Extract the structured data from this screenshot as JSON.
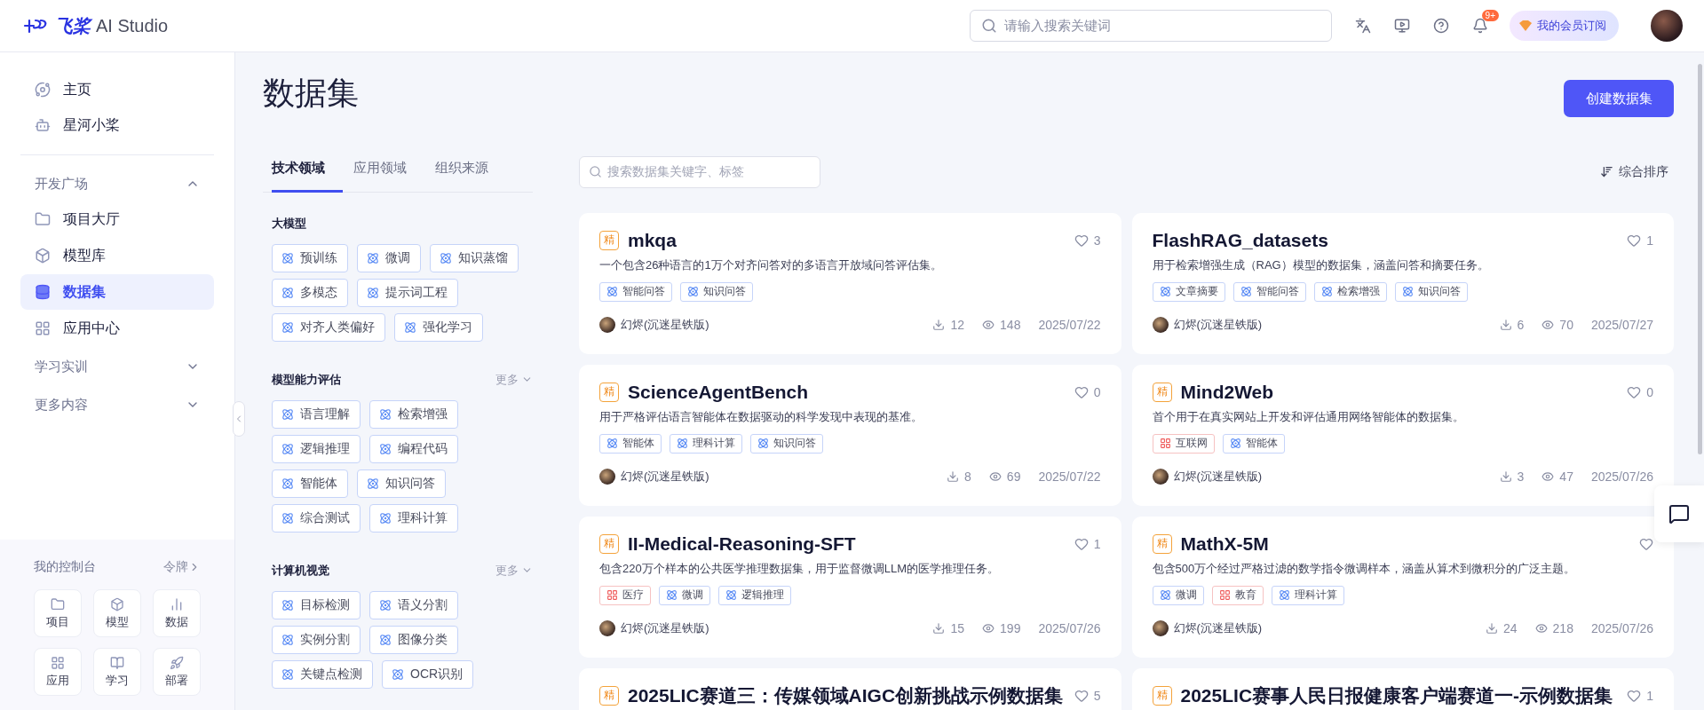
{
  "header": {
    "logo_mark": "飞桨",
    "logo_text": "AI Studio",
    "search": {
      "placeholder": "请输入搜索关键词"
    },
    "notification_badge": "9+",
    "membership_button": "我的会员订阅"
  },
  "sidebar": {
    "top_items": [
      {
        "label": "主页",
        "selected": false
      },
      {
        "label": "星河小桨",
        "selected": false
      }
    ],
    "sections": [
      {
        "label": "开发广场",
        "expanded": true,
        "items": [
          {
            "label": "项目大厅",
            "selected": false
          },
          {
            "label": "模型库",
            "selected": false
          },
          {
            "label": "数据集",
            "selected": true
          },
          {
            "label": "应用中心",
            "selected": false
          }
        ]
      },
      {
        "label": "学习实训",
        "expanded": false
      },
      {
        "label": "更多内容",
        "expanded": false
      }
    ],
    "console": {
      "title": "我的控制台",
      "link": "令牌",
      "shortcuts": [
        "项目",
        "模型",
        "数据",
        "应用",
        "学习",
        "部署"
      ]
    }
  },
  "page": {
    "title": "数据集",
    "create_button": "创建数据集"
  },
  "filters": {
    "tabs": [
      {
        "label": "技术领域",
        "selected": true
      },
      {
        "label": "应用领域",
        "selected": false
      },
      {
        "label": "组织来源",
        "selected": false
      }
    ],
    "groups": [
      {
        "title": "大模型",
        "tags": [
          "预训练",
          "微调",
          "知识蒸馏",
          "多模态",
          "提示词工程",
          "对齐人类偏好",
          "强化学习"
        ]
      },
      {
        "title": "模型能力评估",
        "more": "更多",
        "tags": [
          "语言理解",
          "检索增强",
          "逻辑推理",
          "编程代码",
          "智能体",
          "知识问答",
          "综合测试",
          "理科计算"
        ]
      },
      {
        "title": "计算机视觉",
        "more": "更多",
        "tags": [
          "目标检测",
          "语义分割",
          "实例分割",
          "图像分类",
          "关键点检测",
          "OCR识别"
        ]
      }
    ]
  },
  "search": {
    "placeholder": "搜索数据集关键字、标签"
  },
  "sort": "综合排序",
  "datasets": [
    {
      "badge": "精",
      "title": "mkqa",
      "likes": "3",
      "description": "一个包含26种语言的1万个对齐问答对的多语言开放域问答评估集。",
      "tags": [
        {
          "label": "智能问答",
          "kind": "tech"
        },
        {
          "label": "知识问答",
          "kind": "tech"
        }
      ],
      "author": "幻烬(沉迷星铁版)",
      "downloads": "12",
      "views": "148",
      "date": "2025/07/22"
    },
    {
      "title": "FlashRAG_datasets",
      "likes": "1",
      "description": "用于检索增强生成（RAG）模型的数据集，涵盖问答和摘要任务。",
      "tags": [
        {
          "label": "文章摘要",
          "kind": "tech"
        },
        {
          "label": "智能问答",
          "kind": "tech"
        },
        {
          "label": "检索增强",
          "kind": "tech"
        },
        {
          "label": "知识问答",
          "kind": "tech"
        }
      ],
      "author": "幻烬(沉迷星铁版)",
      "downloads": "6",
      "views": "70",
      "date": "2025/07/27"
    },
    {
      "badge": "精",
      "title": "ScienceAgentBench",
      "likes": "0",
      "description": "用于严格评估语言智能体在数据驱动的科学发现中表现的基准。",
      "tags": [
        {
          "label": "智能体",
          "kind": "tech"
        },
        {
          "label": "理科计算",
          "kind": "tech"
        },
        {
          "label": "知识问答",
          "kind": "tech"
        }
      ],
      "author": "幻烬(沉迷星铁版)",
      "downloads": "8",
      "views": "69",
      "date": "2025/07/22"
    },
    {
      "badge": "精",
      "title": "Mind2Web",
      "likes": "0",
      "description": "首个用于在真实网站上开发和评估通用网络智能体的数据集。",
      "tags": [
        {
          "label": "互联网",
          "kind": "industry"
        },
        {
          "label": "智能体",
          "kind": "tech"
        }
      ],
      "author": "幻烬(沉迷星铁版)",
      "downloads": "3",
      "views": "47",
      "date": "2025/07/26"
    },
    {
      "badge": "精",
      "title": "II-Medical-Reasoning-SFT",
      "likes": "1",
      "description": "包含220万个样本的公共医学推理数据集，用于监督微调LLM的医学推理任务。",
      "tags": [
        {
          "label": "医疗",
          "kind": "industry"
        },
        {
          "label": "微调",
          "kind": "tech"
        },
        {
          "label": "逻辑推理",
          "kind": "tech"
        }
      ],
      "author": "幻烬(沉迷星铁版)",
      "downloads": "15",
      "views": "199",
      "date": "2025/07/26"
    },
    {
      "badge": "精",
      "title": "MathX-5M",
      "description": "包含500万个经过严格过滤的数学指令微调样本，涵盖从算术到微积分的广泛主题。",
      "tags": [
        {
          "label": "微调",
          "kind": "tech"
        },
        {
          "label": "教育",
          "kind": "industry"
        },
        {
          "label": "理科计算",
          "kind": "tech"
        }
      ],
      "author": "幻烬(沉迷星铁版)",
      "downloads": "24",
      "views": "218",
      "date": "2025/07/26"
    },
    {
      "badge": "精",
      "title": "2025LIC赛道三：传媒领域AIGC创新挑战示例数据集",
      "likes": "5"
    },
    {
      "badge": "精",
      "title": "2025LIC赛事人民日报健康客户端赛道一-示例数据集",
      "likes": "1"
    }
  ]
}
